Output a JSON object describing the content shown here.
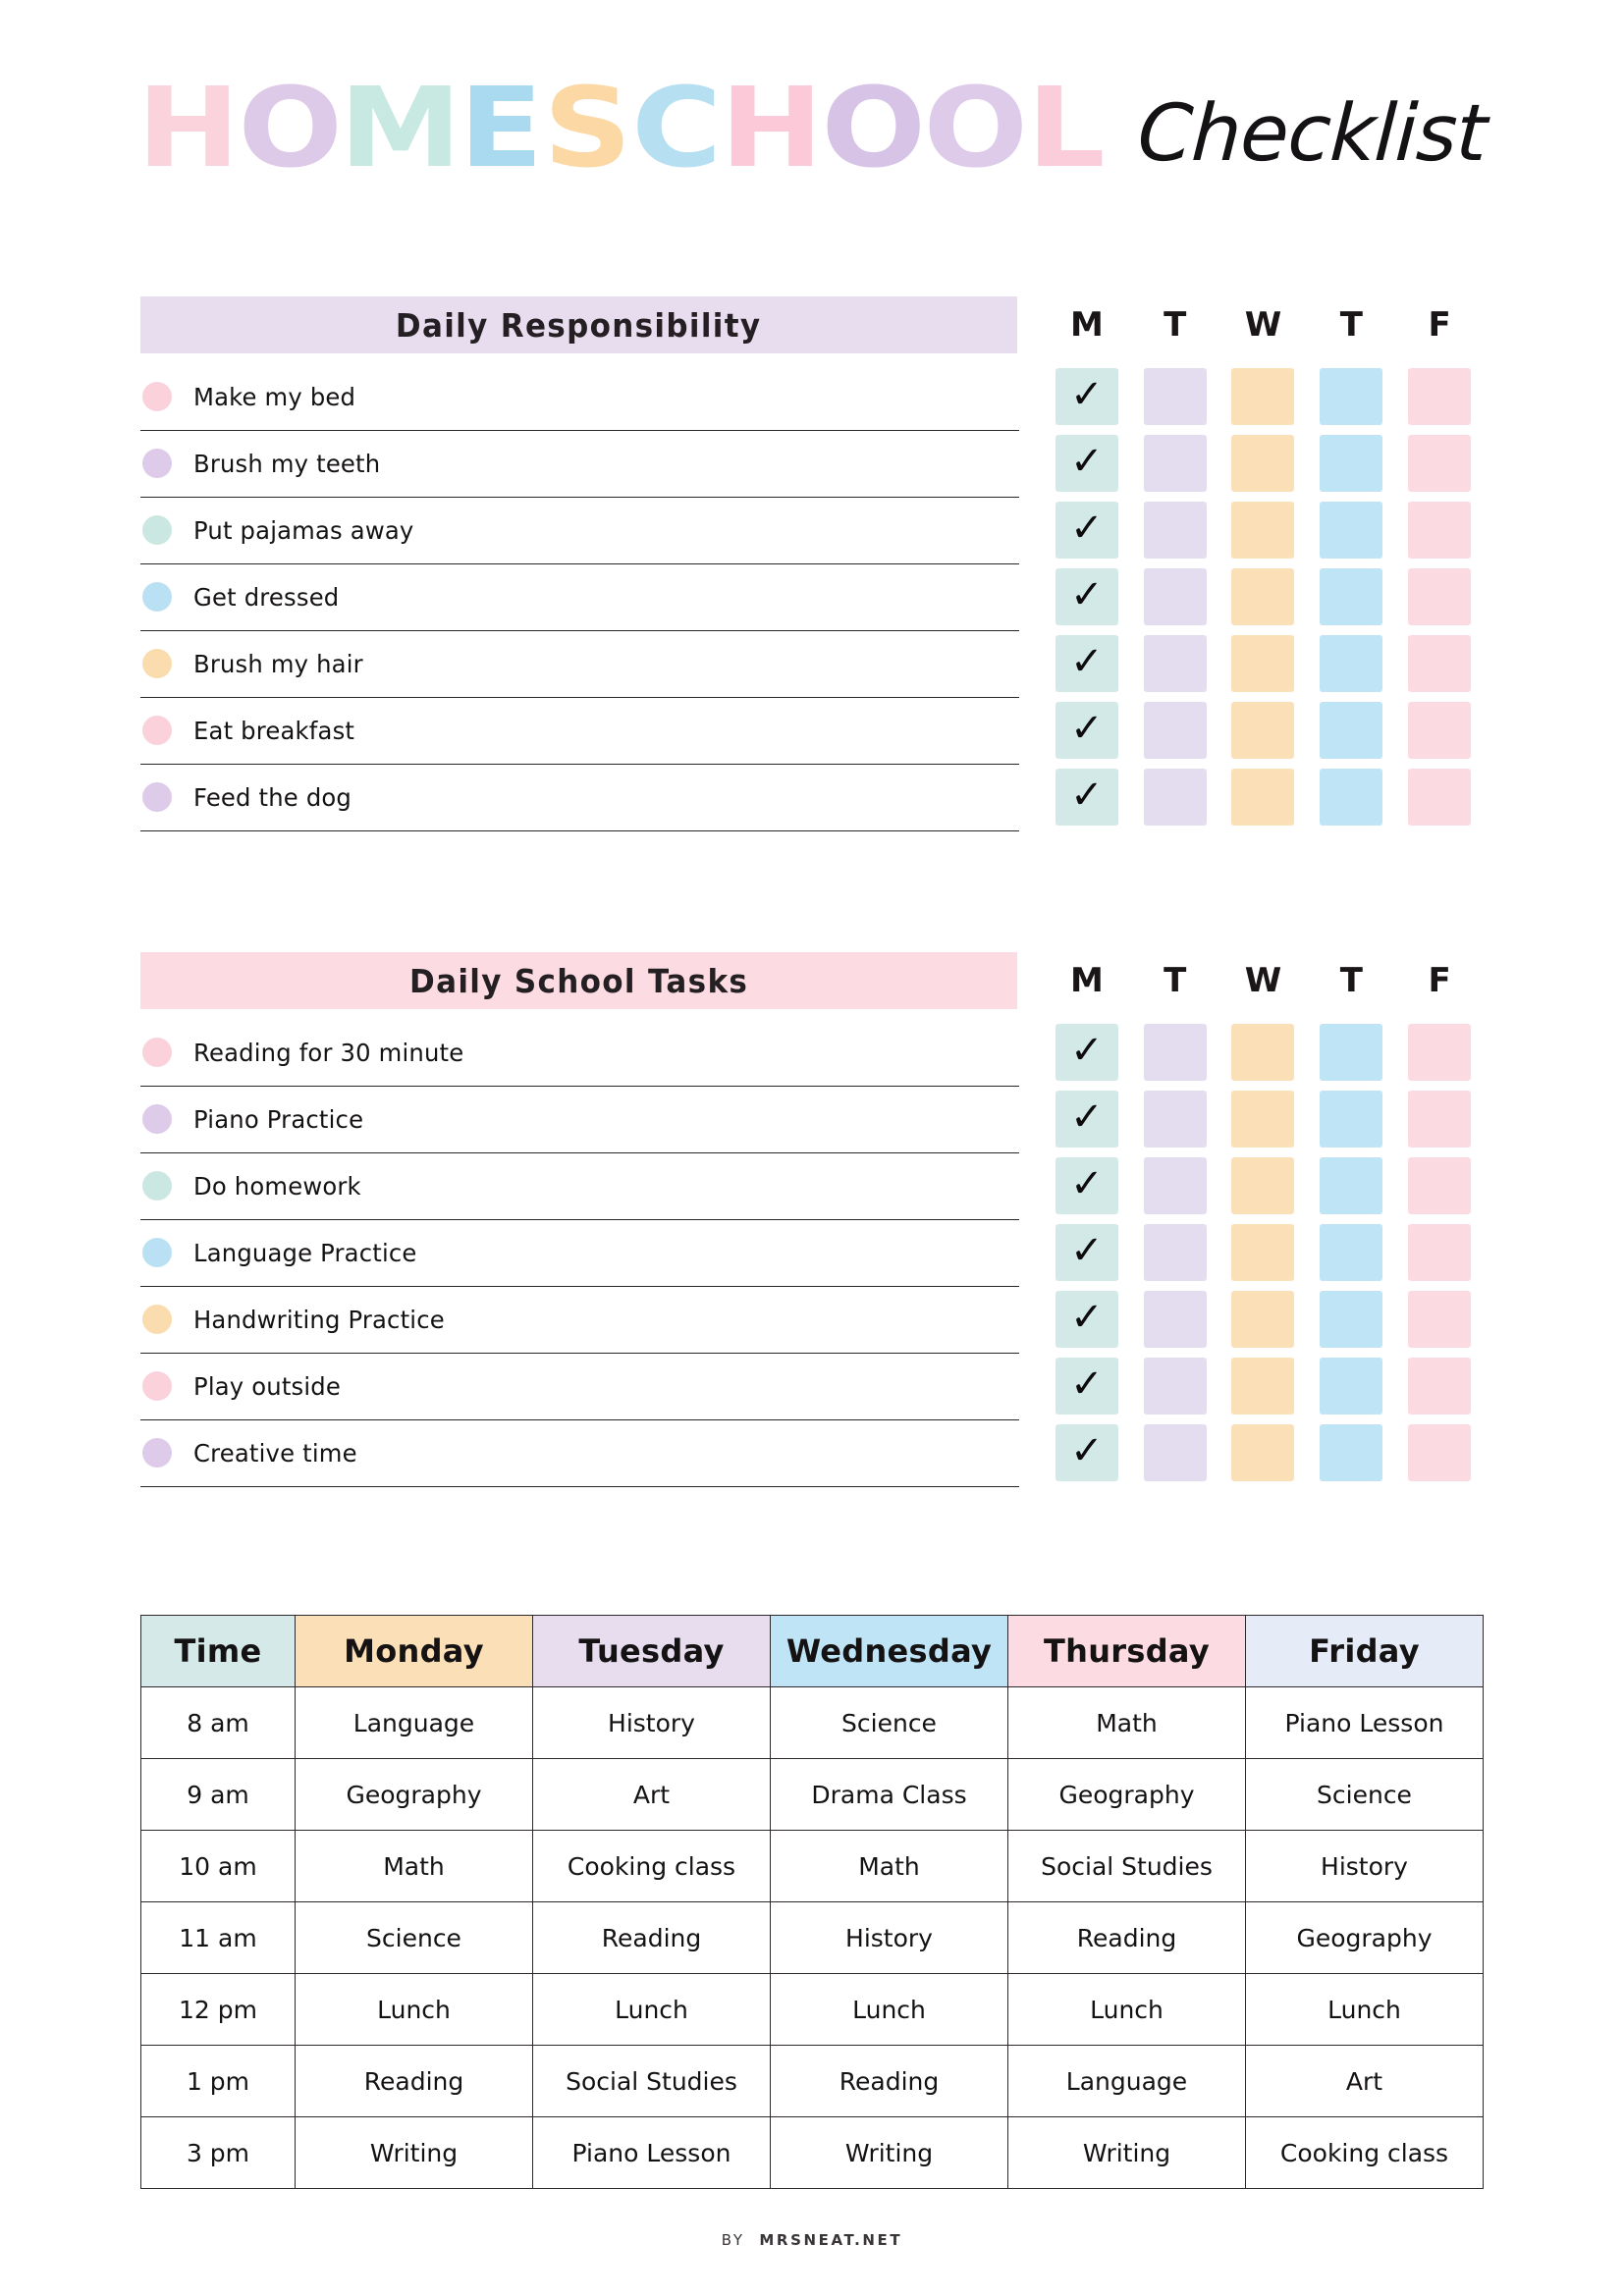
{
  "title": {
    "main_word": "HOMESCHOOL",
    "script_word": "Checklist",
    "letters": [
      {
        "ch": "H",
        "color": "#fbd3dc"
      },
      {
        "ch": "O",
        "color": "#ddc9e8"
      },
      {
        "ch": "M",
        "color": "#c8e8e2"
      },
      {
        "ch": "E",
        "color": "#a9daf0"
      },
      {
        "ch": "S",
        "color": "#fbd8a4"
      },
      {
        "ch": "C",
        "color": "#b6dff2"
      },
      {
        "ch": "H",
        "color": "#fbc9d8"
      },
      {
        "ch": "O",
        "color": "#d6c3e6"
      },
      {
        "ch": "O",
        "color": "#ddcbe9"
      },
      {
        "ch": "L",
        "color": "#fbcddb"
      }
    ]
  },
  "palette": {
    "pink": "#fbd2dc",
    "purple": "#ddcbe9",
    "mint": "#cbe7e2",
    "blue": "#b9e1f3",
    "orange": "#fbdcae",
    "header_lavender": "#e8ddee",
    "header_pink": "#fcdce2",
    "check_mint": "#d2e9e8",
    "check_lavender": "#e4dcef",
    "check_peach": "#fbdfb6",
    "check_blue": "#bfe4f5",
    "check_pink": "#fcdae1"
  },
  "sections": [
    {
      "title": "Daily Responsibility",
      "header_color": "#e8ddee",
      "days": [
        "M",
        "T",
        "W",
        "T",
        "F"
      ],
      "day_colors": [
        "#d2e9e8",
        "#e4dcef",
        "#fbdfb6",
        "#bfe4f5",
        "#fcdae1"
      ],
      "items": [
        {
          "label": "Make my bed",
          "dot": "#fbd2dc",
          "checks": [
            "✓",
            "",
            "",
            "",
            ""
          ]
        },
        {
          "label": "Brush my teeth",
          "dot": "#ddcbe9",
          "checks": [
            "✓",
            "",
            "",
            "",
            ""
          ]
        },
        {
          "label": "Put pajamas away",
          "dot": "#cbe7e2",
          "checks": [
            "✓",
            "",
            "",
            "",
            ""
          ]
        },
        {
          "label": "Get dressed",
          "dot": "#b9e1f3",
          "checks": [
            "✓",
            "",
            "",
            "",
            ""
          ]
        },
        {
          "label": "Brush my hair",
          "dot": "#fbdcae",
          "checks": [
            "✓",
            "",
            "",
            "",
            ""
          ]
        },
        {
          "label": "Eat breakfast",
          "dot": "#fbd2dc",
          "checks": [
            "✓",
            "",
            "",
            "",
            ""
          ]
        },
        {
          "label": "Feed the dog",
          "dot": "#ddcbe9",
          "checks": [
            "✓",
            "",
            "",
            "",
            ""
          ]
        }
      ]
    },
    {
      "title": "Daily School Tasks",
      "header_color": "#fcdce2",
      "days": [
        "M",
        "T",
        "W",
        "T",
        "F"
      ],
      "day_colors": [
        "#d2e9e8",
        "#e4dcef",
        "#fbdfb6",
        "#bfe4f5",
        "#fcdae1"
      ],
      "items": [
        {
          "label": "Reading for 30 minute",
          "dot": "#fbd2dc",
          "checks": [
            "✓",
            "",
            "",
            "",
            ""
          ]
        },
        {
          "label": "Piano Practice",
          "dot": "#ddcbe9",
          "checks": [
            "✓",
            "",
            "",
            "",
            ""
          ]
        },
        {
          "label": "Do homework",
          "dot": "#cbe7e2",
          "checks": [
            "✓",
            "",
            "",
            "",
            ""
          ]
        },
        {
          "label": "Language Practice",
          "dot": "#b9e1f3",
          "checks": [
            "✓",
            "",
            "",
            "",
            ""
          ]
        },
        {
          "label": "Handwriting Practice",
          "dot": "#fbdcae",
          "checks": [
            "✓",
            "",
            "",
            "",
            ""
          ]
        },
        {
          "label": "Play outside",
          "dot": "#fbd2dc",
          "checks": [
            "✓",
            "",
            "",
            "",
            ""
          ]
        },
        {
          "label": "Creative time",
          "dot": "#ddcbe9",
          "checks": [
            "✓",
            "",
            "",
            "",
            ""
          ]
        }
      ]
    }
  ],
  "schedule": {
    "columns": [
      {
        "label": "Time",
        "color": "#d4e9e8"
      },
      {
        "label": "Monday",
        "color": "#fbdfb6"
      },
      {
        "label": "Tuesday",
        "color": "#e7ddef"
      },
      {
        "label": "Wednesday",
        "color": "#bfe4f5"
      },
      {
        "label": "Thursday",
        "color": "#fcdce2"
      },
      {
        "label": "Friday",
        "color": "#e6ecf7"
      }
    ],
    "rows": [
      [
        "8 am",
        "Language",
        "History",
        "Science",
        "Math",
        "Piano Lesson"
      ],
      [
        "9 am",
        "Geography",
        "Art",
        "Drama Class",
        "Geography",
        "Science"
      ],
      [
        "10 am",
        "Math",
        "Cooking class",
        "Math",
        "Social Studies",
        "History"
      ],
      [
        "11 am",
        "Science",
        "Reading",
        "History",
        "Reading",
        "Geography"
      ],
      [
        "12 pm",
        "Lunch",
        "Lunch",
        "Lunch",
        "Lunch",
        "Lunch"
      ],
      [
        "1 pm",
        "Reading",
        "Social Studies",
        "Reading",
        "Language",
        "Art"
      ],
      [
        "3 pm",
        "Writing",
        "Piano Lesson",
        "Writing",
        "Writing",
        "Cooking class"
      ]
    ]
  },
  "footer": {
    "by": "BY",
    "site": "MRSNEAT.NET"
  }
}
